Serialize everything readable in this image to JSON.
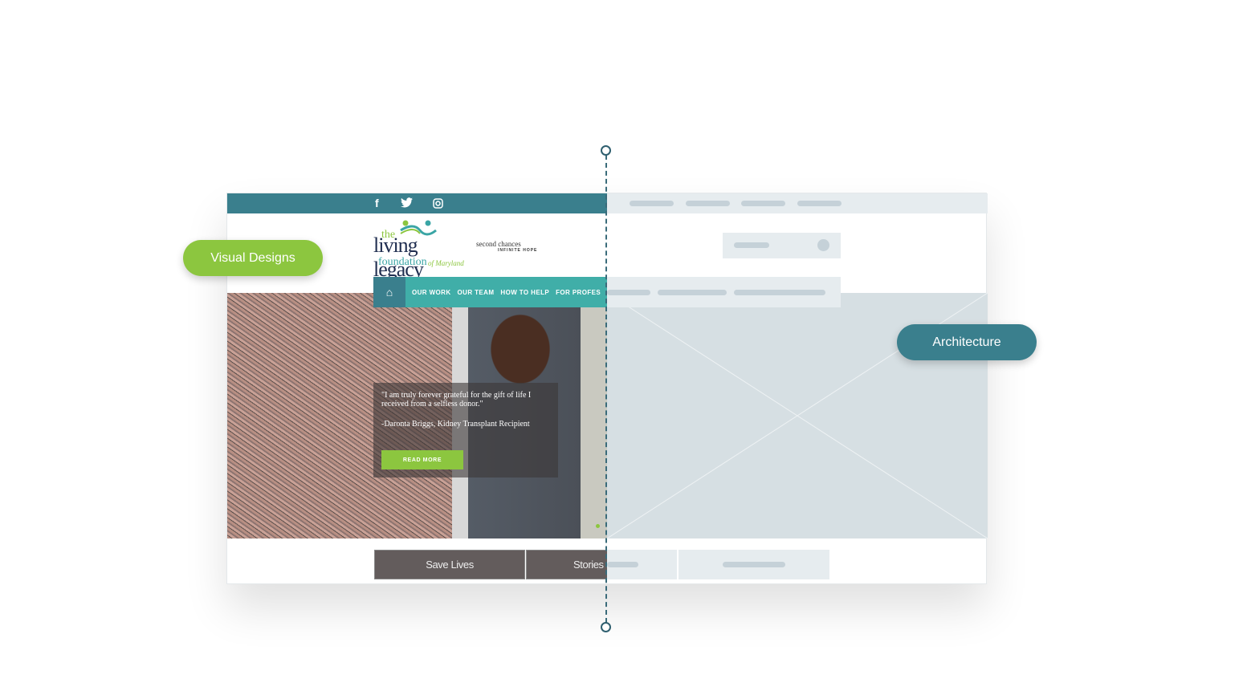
{
  "labels": {
    "visual": "Visual Designs",
    "architecture": "Architecture"
  },
  "colors": {
    "teal_dark": "#3a7f8d",
    "teal": "#40aea8",
    "green": "#8cc63f",
    "button_gray": "#635c5c",
    "wire": "#d6dfe3"
  },
  "site": {
    "social": [
      "facebook-icon",
      "twitter-icon",
      "instagram-icon"
    ],
    "logo": {
      "the": "the",
      "name": "living legacy",
      "foundation": "foundation",
      "state": "of Maryland"
    },
    "tagline": {
      "line1": "second chances",
      "line2": "INFINITE HOPE"
    },
    "nav": [
      "OUR WORK",
      "OUR TEAM",
      "HOW TO HELP",
      "FOR PROFES"
    ],
    "quote": {
      "text": "\"I am truly forever grateful for the gift of life I received from a selfless donor.\"",
      "author": "-Daronta Briggs, Kidney Transplant Recipient",
      "cta": "READ MORE"
    },
    "buttons": [
      "Save Lives",
      "Stories o"
    ]
  }
}
